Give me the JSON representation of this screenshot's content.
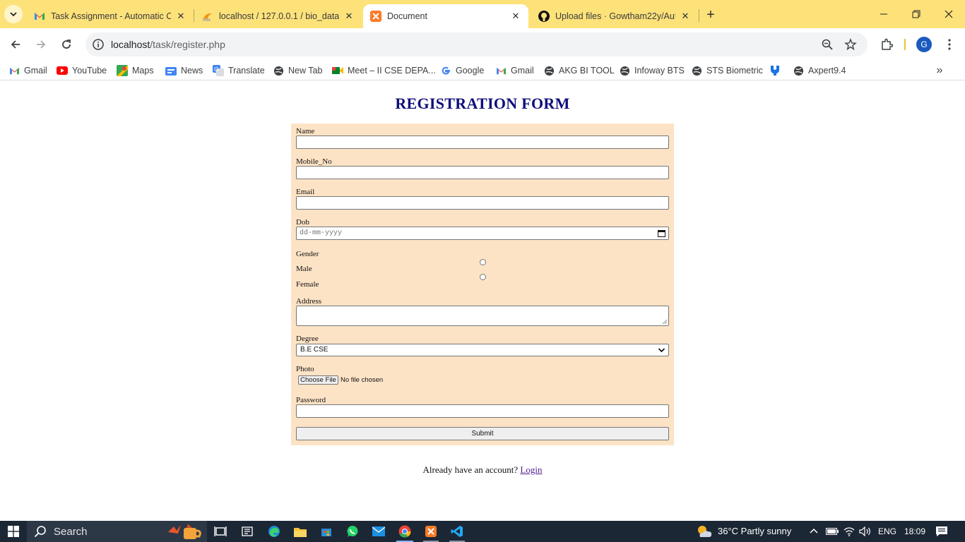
{
  "browser": {
    "tabs": [
      {
        "title": "Task Assignment - Automatic C",
        "favicon": "gmail-icon"
      },
      {
        "title": "localhost / 127.0.0.1 / bio_data",
        "favicon": "phpmyadmin-icon"
      },
      {
        "title": "Document",
        "favicon": "xampp-icon"
      },
      {
        "title": "Upload files · Gowtham22y/Aut",
        "favicon": "github-icon"
      }
    ],
    "address": {
      "host": "localhost",
      "path": "/task/register.php"
    },
    "bookmarks": [
      "Gmail",
      "YouTube",
      "Maps",
      "News",
      "Translate",
      "New Tab",
      "Meet – II CSE DEPA...",
      "Google",
      "Gmail",
      "AKG BI TOOL",
      "Infoway BTS",
      "STS Biometric",
      "",
      "Axpert9.4"
    ],
    "profile_initial": "G"
  },
  "form": {
    "title": "REGISTRATION FORM",
    "labels": {
      "name": "Name",
      "mobile": "Mobile_No",
      "email": "Email",
      "dob": "Dob",
      "gender": "Gender",
      "male": "Male",
      "female": "Female",
      "address": "Address",
      "degree": "Degree",
      "photo": "Photo",
      "password": "Password"
    },
    "dob_placeholder": "dd-mm-yyyy",
    "degree_selected": "B.E CSE",
    "file_button": "Choose File",
    "file_status": "No file chosen",
    "submit_label": "Submit",
    "login_prompt": "Already have an account?",
    "login_link": "Login"
  },
  "taskbar": {
    "search_label": "Search",
    "weather": "36°C  Partly sunny",
    "language": "ENG",
    "time": "18:09"
  },
  "colors": {
    "tabstrip": "#fde27a",
    "form_bg": "#fde3c6",
    "title": "#0d0d7a",
    "taskbar": "#1c2735"
  }
}
